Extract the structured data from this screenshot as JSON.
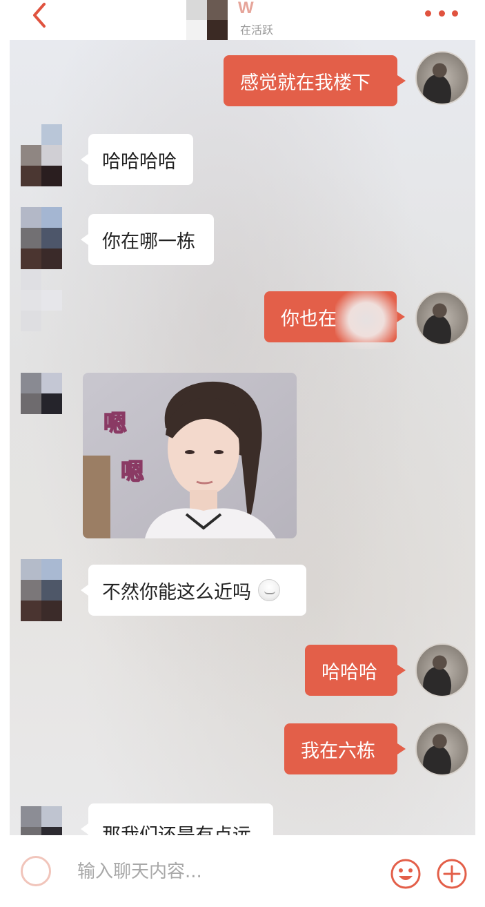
{
  "header": {
    "name": "W",
    "status": "在活跃",
    "back_icon": "chevron-left-icon",
    "more_icon": "more-dots-icon"
  },
  "colors": {
    "accent": "#e35f49",
    "incoming_bubble": "#ffffff",
    "chat_background": "#e6e6e6"
  },
  "messages": [
    {
      "side": "out",
      "text": "感觉就在我楼下"
    },
    {
      "side": "in",
      "text": "哈哈哈哈"
    },
    {
      "side": "in",
      "text": "你在哪一栋"
    },
    {
      "side": "out",
      "text": "你也在"
    },
    {
      "side": "in",
      "type": "sticker",
      "sticker_text": [
        "嗯",
        "嗯"
      ]
    },
    {
      "side": "in",
      "text": "不然你能这么近吗"
    },
    {
      "side": "out",
      "text": "哈哈哈"
    },
    {
      "side": "out",
      "text": "我在六栋"
    },
    {
      "side": "in",
      "text": "那我们还是有点远"
    }
  ],
  "input": {
    "placeholder": "输入聊天内容...",
    "value": "",
    "voice_icon": "voice-icon",
    "emoji_icon": "smiley-icon",
    "plus_icon": "plus-circle-icon"
  }
}
